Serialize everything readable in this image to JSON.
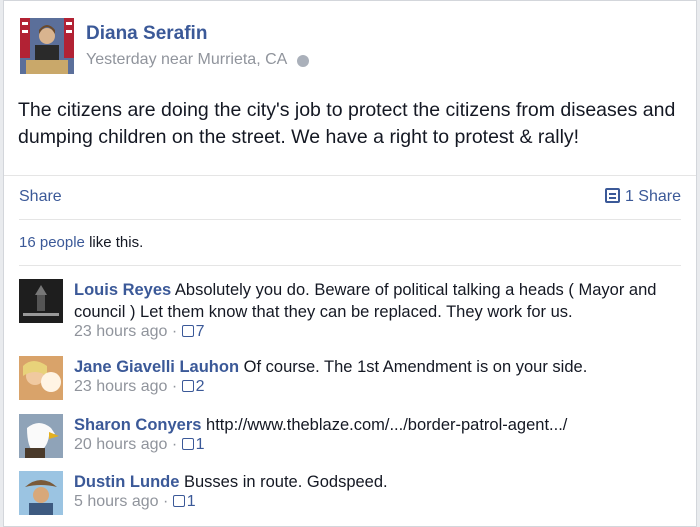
{
  "post": {
    "author": "Diana Serafin",
    "time": "Yesterday",
    "near_word": "near",
    "location": "Murrieta, CA",
    "text": "The citizens are doing the city's job to protect the citizens from diseases and dumping children on the street. We have a right to protest & rally!"
  },
  "actions": {
    "share_label": "Share",
    "share_count": "1 Share"
  },
  "likes": {
    "people": "16 people",
    "suffix": " like this."
  },
  "comments": [
    {
      "name": "Louis Reyes",
      "text": "Absolutely you do. Beware of political talking a heads ( Mayor and council ) Let them know that they can be replaced. They work for us.",
      "time": "23 hours ago",
      "likes": "7"
    },
    {
      "name": "Jane Giavelli Lauhon",
      "text": "Of course. The 1st Amendment is on your side.",
      "time": "23 hours ago",
      "likes": "2"
    },
    {
      "name": "Sharon Conyers",
      "text": "http://www.theblaze.com/.../border-patrol-agent.../",
      "time": "20 hours ago",
      "likes": "1"
    },
    {
      "name": "Dustin Lunde",
      "text": "Busses in route. Godspeed.",
      "time": "5 hours ago",
      "likes": "1"
    }
  ],
  "colors": {
    "link": "#3b5998",
    "muted": "#90949c",
    "text": "#141823"
  }
}
